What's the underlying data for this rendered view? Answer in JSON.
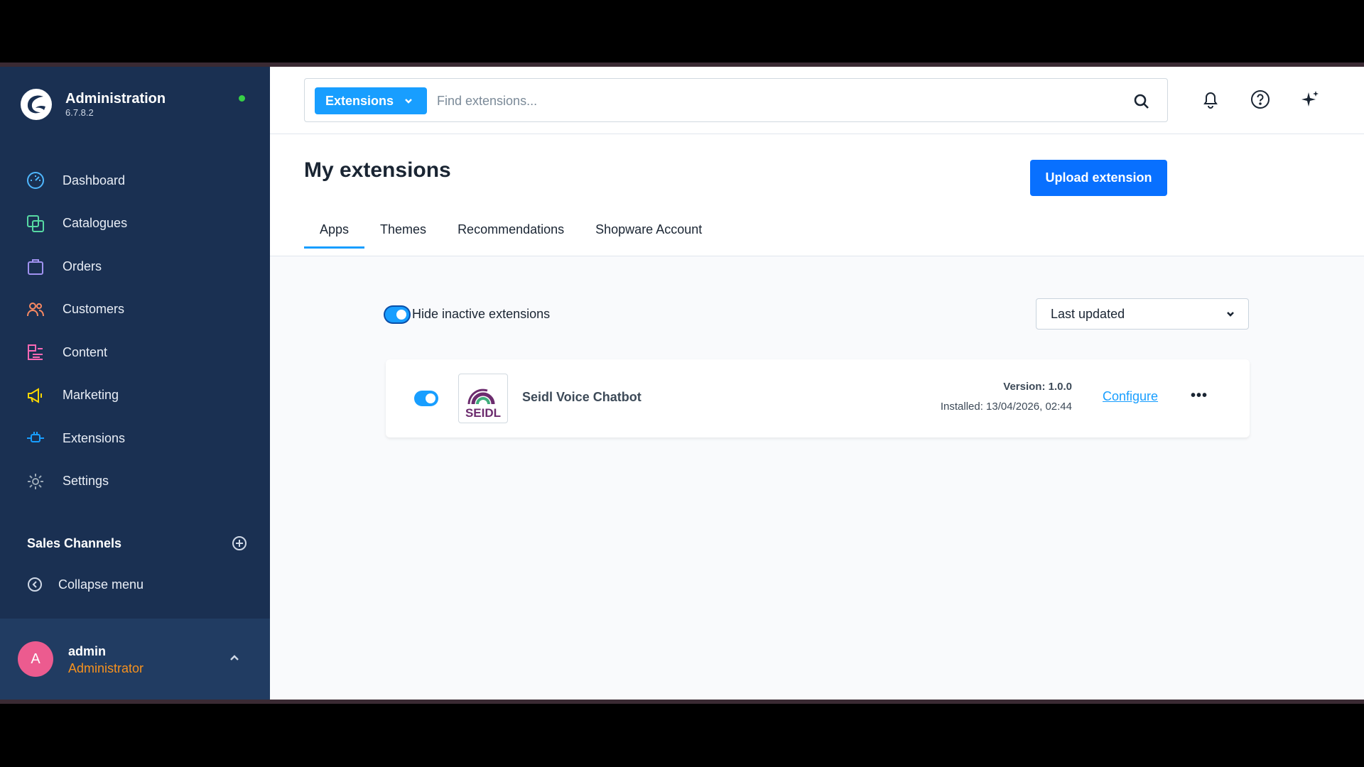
{
  "sidebar": {
    "brand_title": "Administration",
    "brand_version": "6.7.8.2",
    "items": [
      {
        "label": "Dashboard",
        "icon": "dashboard-icon",
        "color": "#4fb7ff"
      },
      {
        "label": "Catalogues",
        "icon": "catalogue-icon",
        "color": "#57d9a3"
      },
      {
        "label": "Orders",
        "icon": "orders-icon",
        "color": "#a092f0"
      },
      {
        "label": "Customers",
        "icon": "customers-icon",
        "color": "#f88962"
      },
      {
        "label": "Content",
        "icon": "content-icon",
        "color": "#ff68b4"
      },
      {
        "label": "Marketing",
        "icon": "marketing-icon",
        "color": "#ffd700"
      },
      {
        "label": "Extensions",
        "icon": "extensions-icon",
        "color": "#189eff"
      },
      {
        "label": "Settings",
        "icon": "settings-icon",
        "color": "#9aa8b5"
      }
    ],
    "sales_channels_title": "Sales Channels",
    "collapse_label": "Collapse menu",
    "user": {
      "initial": "A",
      "name": "admin",
      "role": "Administrator"
    }
  },
  "topbar": {
    "search_type_label": "Extensions",
    "search_placeholder": "Find extensions..."
  },
  "page": {
    "title": "My extensions",
    "upload_label": "Upload extension",
    "tabs": [
      {
        "label": "Apps",
        "active": true
      },
      {
        "label": "Themes",
        "active": false
      },
      {
        "label": "Recommendations",
        "active": false
      },
      {
        "label": "Shopware Account",
        "active": false
      }
    ]
  },
  "filter": {
    "hide_inactive_label": "Hide inactive extensions",
    "hide_inactive_on": true,
    "sort_value": "Last updated"
  },
  "extension": {
    "name": "Seidl Voice Chatbot",
    "logo_text": "SEIDL",
    "version": "Version: 1.0.0",
    "installed": "Installed: 13/04/2026, 02:44",
    "configure_label": "Configure",
    "active": true
  },
  "colors": {
    "sidebar_bg": "#1a3052",
    "accent": "#189eff",
    "primary_button": "#0870ff",
    "status_online": "#37d046",
    "role_text": "#f7921e",
    "avatar_bg": "#ec5b8f"
  }
}
